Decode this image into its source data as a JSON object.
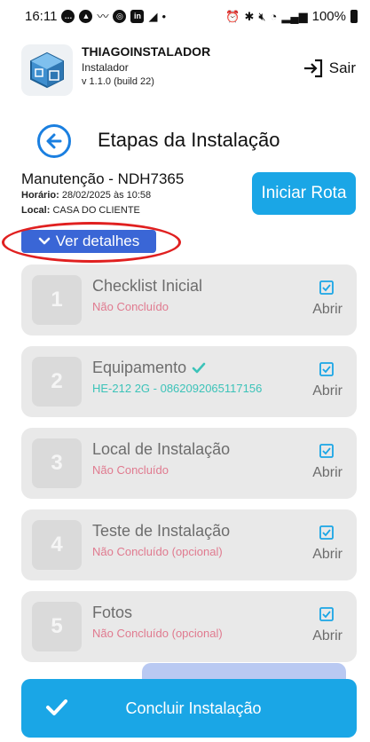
{
  "status_bar": {
    "time": "16:11",
    "battery": "100%"
  },
  "app": {
    "name": "THIAGOINSTALADOR",
    "role": "Instalador",
    "version": "v 1.1.0 (build 22)",
    "logout_label": "Sair"
  },
  "page": {
    "title": "Etapas da Instalação"
  },
  "maintenance": {
    "title": "Manutenção - NDH7365",
    "time_label": "Horário:",
    "time_value": "28/02/2025 às 10:58",
    "place_label": "Local:",
    "place_value": "CASA DO CLIENTE",
    "start_route_label": "Iniciar Rota",
    "details_label": "Ver detalhes"
  },
  "steps": [
    {
      "number": "1",
      "title": "Checklist Inicial",
      "status": "Não Concluído",
      "completed": false,
      "open_label": "Abrir"
    },
    {
      "number": "2",
      "title": "Equipamento",
      "status": "HE-212 2G - 0862092065117156",
      "completed": true,
      "open_label": "Abrir"
    },
    {
      "number": "3",
      "title": "Local de Instalação",
      "status": "Não Concluído",
      "completed": false,
      "open_label": "Abrir"
    },
    {
      "number": "4",
      "title": "Teste de Instalação",
      "status": "Não Concluído (opcional)",
      "completed": false,
      "open_label": "Abrir"
    },
    {
      "number": "5",
      "title": "Fotos",
      "status": "Não Concluído (opcional)",
      "completed": false,
      "open_label": "Abrir"
    }
  ],
  "footer": {
    "finish_label": "Concluir Instalação"
  },
  "colors": {
    "primary": "#1aa6e6",
    "details_button": "#3a66d6",
    "highlight_ellipse": "#e02020",
    "pending_status": "#e07a8f",
    "done_status": "#3cc3b9",
    "card_background": "#e9e9e9",
    "back_arrow": "#1a7fe0"
  }
}
